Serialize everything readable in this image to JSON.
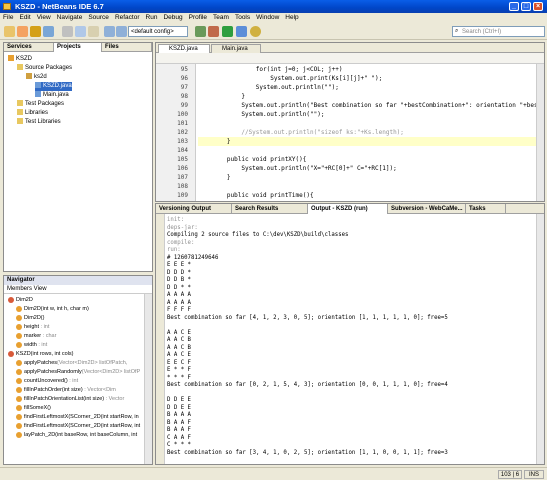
{
  "window": {
    "title": "KSZD - NetBeans IDE 6.7",
    "min": "_",
    "max": "□",
    "close": "×"
  },
  "menu": [
    "File",
    "Edit",
    "View",
    "Navigate",
    "Source",
    "Refactor",
    "Run",
    "Debug",
    "Profile",
    "Team",
    "Tools",
    "Window",
    "Help"
  ],
  "toolbar": {
    "config": "<default config>",
    "search_placeholder": "Search (Ctrl+I)"
  },
  "projects_panel": {
    "tabs": [
      "Services",
      "Projects",
      "Files"
    ],
    "tree": [
      {
        "label": "KSZD",
        "depth": 0,
        "icon": "project-icon"
      },
      {
        "label": "Source Packages",
        "depth": 1,
        "icon": "folder-icon"
      },
      {
        "label": "ks2d",
        "depth": 2,
        "icon": "package-icon"
      },
      {
        "label": "KSZD.java",
        "depth": 3,
        "icon": "java-file-icon",
        "selected": true
      },
      {
        "label": "Main.java",
        "depth": 3,
        "icon": "java-file-icon"
      },
      {
        "label": "Test Packages",
        "depth": 1,
        "icon": "folder-icon"
      },
      {
        "label": "Libraries",
        "depth": 1,
        "icon": "folder-icon"
      },
      {
        "label": "Test Libraries",
        "depth": 1,
        "icon": "folder-icon"
      }
    ]
  },
  "navigator": {
    "title": "Navigator",
    "view": "Members View",
    "items": [
      {
        "name": "Dim2D",
        "extra": "",
        "depth": 0
      },
      {
        "name": "Dim2D(int w, int h, char m)",
        "extra": "",
        "depth": 1
      },
      {
        "name": "Dim2D()",
        "extra": "",
        "depth": 1
      },
      {
        "name": "height",
        "extra": " : int",
        "depth": 1
      },
      {
        "name": "marker",
        "extra": " : char",
        "depth": 1
      },
      {
        "name": "width",
        "extra": " : int",
        "depth": 1
      },
      {
        "name": "KSZD(int rows, int cols)",
        "extra": "",
        "depth": 0
      },
      {
        "name": "applyPatches",
        "extra": "(Vector<Dim2D> listOfPatch,",
        "depth": 1
      },
      {
        "name": "applyPatchesRandomly",
        "extra": "(Vector<Dim2D> listOfP",
        "depth": 1
      },
      {
        "name": "countUncovered()",
        "extra": " : int",
        "depth": 1
      },
      {
        "name": "fillInPatchOrder(int size)",
        "extra": " : Vector<Dim",
        "depth": 1
      },
      {
        "name": "fillInPatchOrientationList(int size)",
        "extra": " : Vector",
        "depth": 1
      },
      {
        "name": "fillSomeX()",
        "extra": "",
        "depth": 1
      },
      {
        "name": "findFirstLeftmostX(SCorner_2D(int startRow, in",
        "extra": "",
        "depth": 1
      },
      {
        "name": "findFirstLeftmostX(SCorner_2D(int startRow, int",
        "extra": "",
        "depth": 1
      },
      {
        "name": "layPatch_2D(int baseRow, int baseColumn, int",
        "extra": "",
        "depth": 1
      }
    ]
  },
  "editor": {
    "tabs": [
      "KSZD.java",
      "Main.java"
    ],
    "lines": [
      {
        "n": "95",
        "t": "                for(int j=0; j<COL; j++)"
      },
      {
        "n": "96",
        "t": "                    System.out.print(Ks[i][j]+\" \");"
      },
      {
        "n": "97",
        "t": "                System.out.println(\"\");"
      },
      {
        "n": "98",
        "t": "            }"
      },
      {
        "n": "99",
        "t": "            System.out.println(\"Best combination so far \"+bestCombination+\": orientation \"+best"
      },
      {
        "n": "100",
        "t": "            System.out.println(\"\");"
      },
      {
        "n": "101",
        "t": ""
      },
      {
        "n": "102",
        "t": "            //System.out.println(\"sizeof ks:\"+Ks.length);"
      },
      {
        "n": "103",
        "t": "        }"
      },
      {
        "n": "104",
        "t": ""
      },
      {
        "n": "105",
        "t": "        public void printXY(){"
      },
      {
        "n": "106",
        "t": "            System.out.println(\"X=\"+RC[0]+\" C=\"+RC[1]);"
      },
      {
        "n": "107",
        "t": "        }"
      },
      {
        "n": "108",
        "t": ""
      },
      {
        "n": "109",
        "t": "        public void printTime(){"
      }
    ]
  },
  "output": {
    "tabs": [
      "Versioning Output",
      "Search Results",
      "Output - KSZD (run)",
      "Subversion - WebCaMe...",
      "Tasks"
    ],
    "lines": [
      {
        "t": "init:",
        "gray": true
      },
      {
        "t": "deps-jar:",
        "gray": true
      },
      {
        "t": "Compiling 2 source files to C:\\dev\\KSZD\\build\\classes",
        "gray": false
      },
      {
        "t": "compile:",
        "gray": true
      },
      {
        "t": "run:",
        "gray": true
      },
      {
        "t": "# 1260781249646",
        "gray": false
      },
      {
        "t": "E E E *",
        "gray": false
      },
      {
        "t": "D D D *",
        "gray": false
      },
      {
        "t": "D D B *",
        "gray": false
      },
      {
        "t": "D D * *",
        "gray": false
      },
      {
        "t": "A A A A",
        "gray": false
      },
      {
        "t": "A A A A",
        "gray": false
      },
      {
        "t": "F F F F",
        "gray": false
      },
      {
        "t": "Best combination so far [4, 1, 2, 3, 0, 5]; orientation [1, 1, 1, 1, 1, 0]; free=5",
        "gray": false
      },
      {
        "t": "",
        "gray": false
      },
      {
        "t": "A A C E",
        "gray": false
      },
      {
        "t": "A A C B",
        "gray": false
      },
      {
        "t": "A A C B",
        "gray": false
      },
      {
        "t": "A A C E",
        "gray": false
      },
      {
        "t": "E E C F",
        "gray": false
      },
      {
        "t": "E * * F",
        "gray": false
      },
      {
        "t": "* * * F",
        "gray": false
      },
      {
        "t": "Best combination so far [0, 2, 1, 5, 4, 3]; orientation [0, 0, 1, 1, 1, 0]; free=4",
        "gray": false
      },
      {
        "t": "",
        "gray": false
      },
      {
        "t": "D D E E",
        "gray": false
      },
      {
        "t": "D D E E",
        "gray": false
      },
      {
        "t": "B A A A",
        "gray": false
      },
      {
        "t": "B A A F",
        "gray": false
      },
      {
        "t": "B A A F",
        "gray": false
      },
      {
        "t": "C A A F",
        "gray": false
      },
      {
        "t": "C * * *",
        "gray": false
      },
      {
        "t": "Best combination so far [3, 4, 1, 0, 2, 5]; orientation [1, 1, 0, 0, 1, 1]; free=3",
        "gray": false
      }
    ]
  },
  "status": {
    "position": "103 | 6",
    "mode": "INS"
  },
  "colors": {
    "titlebar": "#0a5ee8",
    "selection": "#316ac5",
    "string": "#ce7b00",
    "line_highlight": "#ffffc8"
  }
}
